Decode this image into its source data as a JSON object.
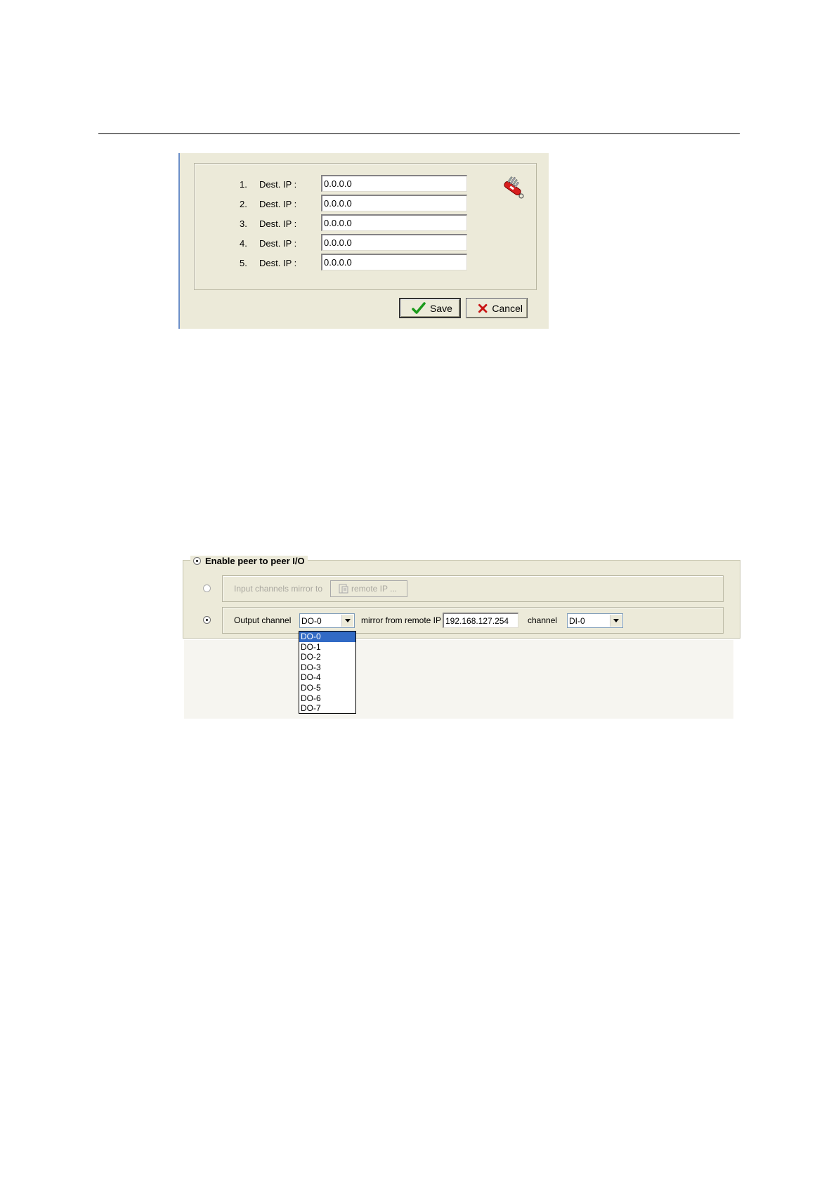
{
  "dest_ip_dialog": {
    "rows": [
      {
        "num": "1.",
        "label": "Dest. IP :",
        "value": "0.0.0.0"
      },
      {
        "num": "2.",
        "label": "Dest. IP :",
        "value": "0.0.0.0"
      },
      {
        "num": "3.",
        "label": "Dest. IP :",
        "value": "0.0.0.0"
      },
      {
        "num": "4.",
        "label": "Dest. IP :",
        "value": "0.0.0.0"
      },
      {
        "num": "5.",
        "label": "Dest. IP :",
        "value": "0.0.0.0"
      }
    ],
    "tool_icon": "swiss-knife-icon",
    "save_label": "Save",
    "cancel_label": "Cancel"
  },
  "peer_io": {
    "legend": "Enable peer to peer I/O",
    "input_mirror_label": "Input channels mirror to",
    "remote_ip_button": "remote IP ...",
    "output_channel_label": "Output channel",
    "output_channel_value": "DO-0",
    "mirror_from_label": "mirror from remote IP",
    "remote_ip_value": "192.168.127.254",
    "channel_label": "channel",
    "channel_value": "DI-0",
    "dropdown_options": [
      "DO-0",
      "DO-1",
      "DO-2",
      "DO-3",
      "DO-4",
      "DO-5",
      "DO-6",
      "DO-7"
    ]
  },
  "colors": {
    "panel_bg": "#ecead9",
    "selection": "#316ac5",
    "save_check": "#1a9a1a",
    "cancel_x": "#c81414"
  }
}
